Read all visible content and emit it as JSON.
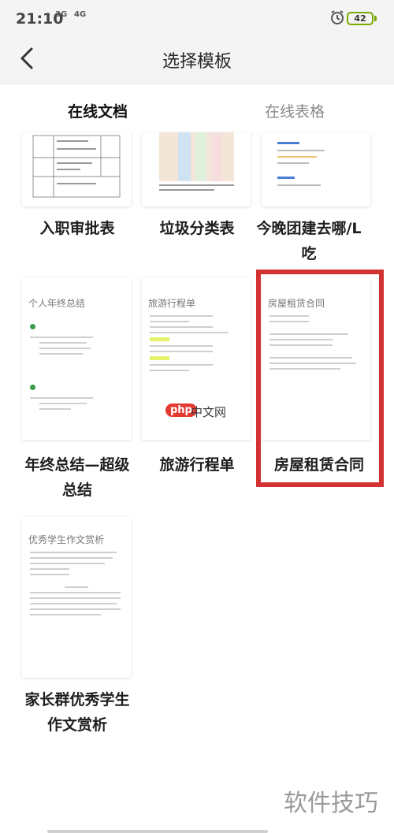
{
  "status": {
    "time": "21:10",
    "net1": "3G",
    "net2": "4G",
    "battery": "42"
  },
  "nav": {
    "title": "选择模板"
  },
  "tabs": [
    {
      "label": "在线文档",
      "active": true
    },
    {
      "label": "在线表格",
      "active": false
    }
  ],
  "templates": [
    {
      "label": "入职审批表"
    },
    {
      "label": "垃圾分类表"
    },
    {
      "label": "今晚团建去哪/L吃"
    },
    {
      "label": "年终总结—超级总结",
      "thumb_title": "个人年终总结"
    },
    {
      "label": "旅游行程单",
      "thumb_title": "旅游行程单"
    },
    {
      "label": "房屋租赁合同",
      "thumb_title": "房屋租赁合同",
      "selected": true
    },
    {
      "label": "家长群优秀学生作文赏析",
      "thumb_title": "优秀学生作文赏析"
    }
  ],
  "watermark": {
    "badge": "php",
    "text": "中文网"
  },
  "brand": "软件技巧",
  "colors": {
    "selection": "#d23232",
    "accent_green": "#3a9b48"
  }
}
